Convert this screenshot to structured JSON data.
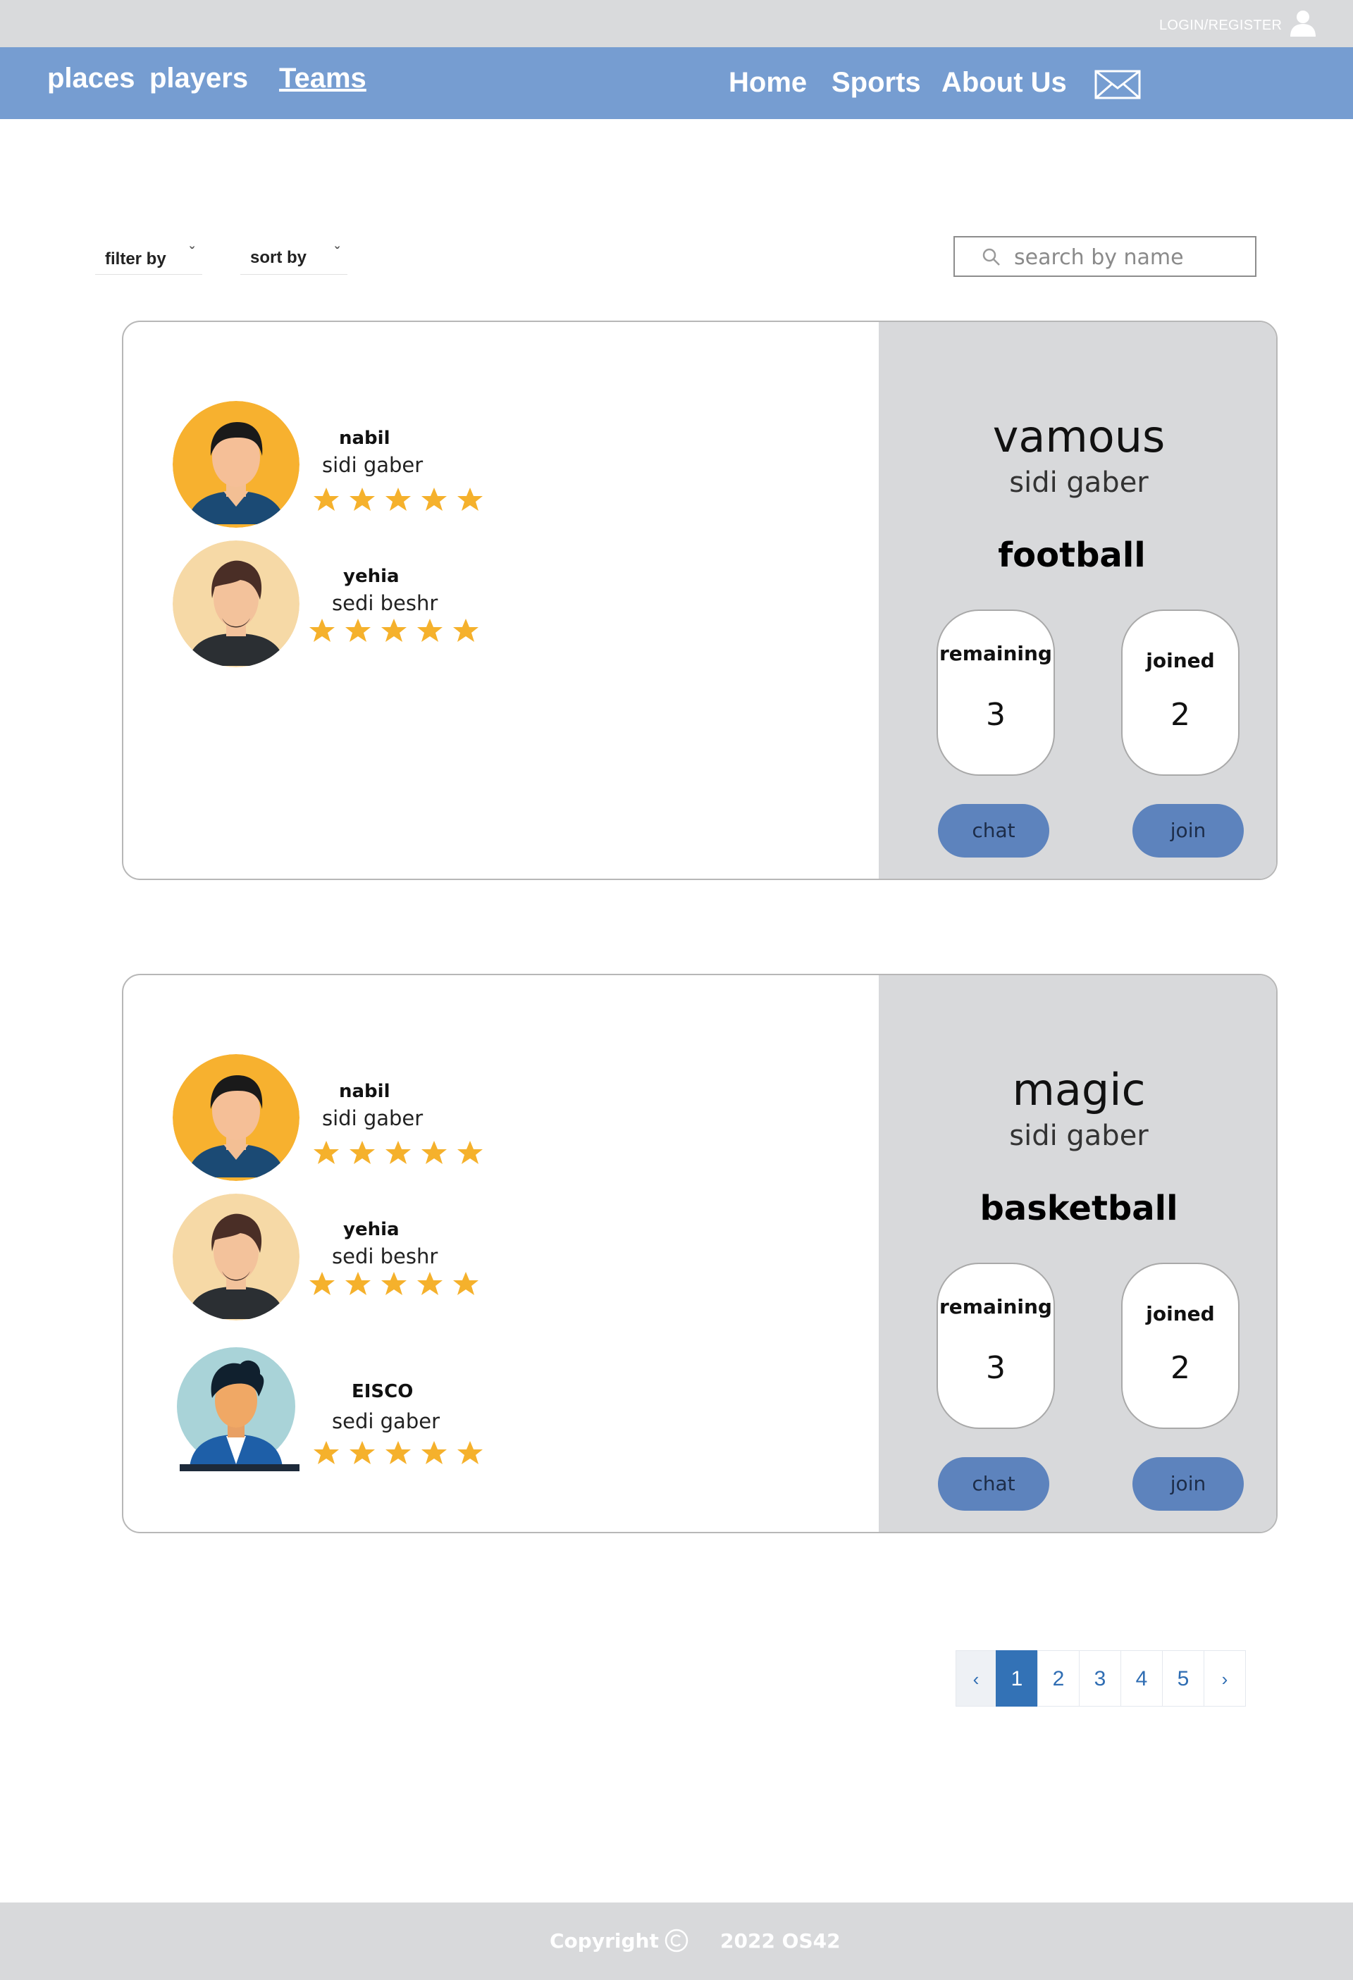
{
  "header": {
    "login_label": "LOGIN/REGISTER",
    "user_icon": "user-icon"
  },
  "nav": {
    "left": [
      "places",
      "players",
      "Teams"
    ],
    "active": "Teams",
    "right": [
      "Home",
      "Sports",
      "About Us"
    ],
    "mail_icon": "mail-icon"
  },
  "controls": {
    "filter_label": "filter by",
    "sort_label": "sort by",
    "search_placeholder": "search by name"
  },
  "teams": [
    {
      "name": "vamous",
      "location": "sidi gaber",
      "sport": "football",
      "remaining_label": "remaining",
      "remaining": "3",
      "joined_label": "joined",
      "joined": "2",
      "chat_label": "chat",
      "join_label": "join",
      "players": [
        {
          "name": "nabil",
          "location": "sidi gaber",
          "rating": 5
        },
        {
          "name": "yehia",
          "location": "sedi beshr",
          "rating": 5
        }
      ]
    },
    {
      "name": "magic",
      "location": "sidi gaber",
      "sport": "basketball",
      "remaining_label": "remaining",
      "remaining": "3",
      "joined_label": "joined",
      "joined": "2",
      "chat_label": "chat",
      "join_label": "join",
      "players": [
        {
          "name": "nabil",
          "location": "sidi gaber",
          "rating": 5
        },
        {
          "name": "yehia",
          "location": "sedi beshr",
          "rating": 5
        },
        {
          "name": "EISCO",
          "location": "sedi gaber",
          "rating": 5
        }
      ]
    }
  ],
  "pagination": {
    "prev": "‹",
    "pages": [
      "1",
      "2",
      "3",
      "4",
      "5"
    ],
    "active": "1",
    "next": "›"
  },
  "footer": {
    "copyright_label": "Copyright",
    "copyright_icon": "copyright-icon",
    "year_text": "2022 OS42"
  },
  "colors": {
    "nav_bg": "#769dd1",
    "top_bg": "#d9dadc",
    "button": "#5d83bd",
    "star": "#f5b12c",
    "pager_active": "#3372b6"
  }
}
